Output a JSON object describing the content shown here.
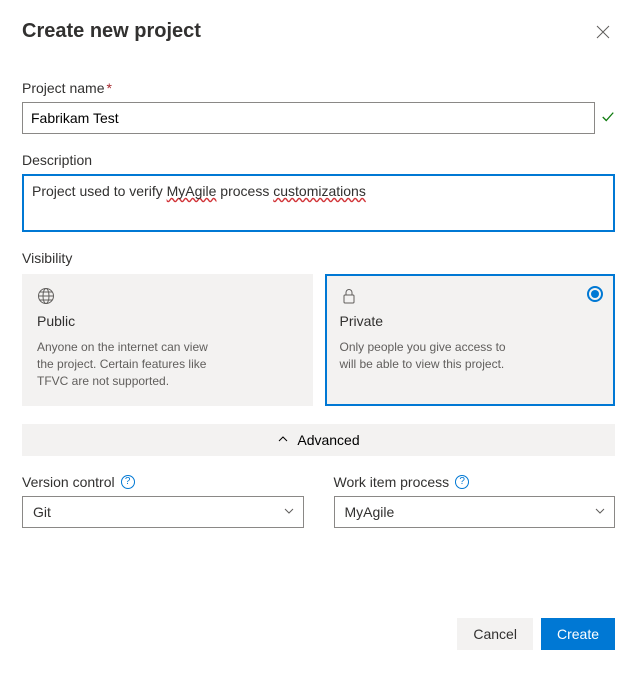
{
  "dialog": {
    "title": "Create new project"
  },
  "fields": {
    "projectName": {
      "label": "Project name",
      "required": "*",
      "value": "Fabrikam Test"
    },
    "description": {
      "label": "Description",
      "prefix": "Project used to verify ",
      "spell1": "MyAgile",
      "middle": " process ",
      "spell2": "customizations"
    },
    "visibility": {
      "label": "Visibility"
    }
  },
  "visibility": {
    "public": {
      "title": "Public",
      "desc": "Anyone on the internet can view the project. Certain features like TFVC are not supported."
    },
    "private": {
      "title": "Private",
      "desc": "Only people you give access to will be able to view this project."
    }
  },
  "advanced": {
    "toggle": "Advanced",
    "versionControl": {
      "label": "Version control",
      "value": "Git"
    },
    "workItemProcess": {
      "label": "Work item process",
      "value": "MyAgile"
    }
  },
  "footer": {
    "cancel": "Cancel",
    "create": "Create"
  }
}
